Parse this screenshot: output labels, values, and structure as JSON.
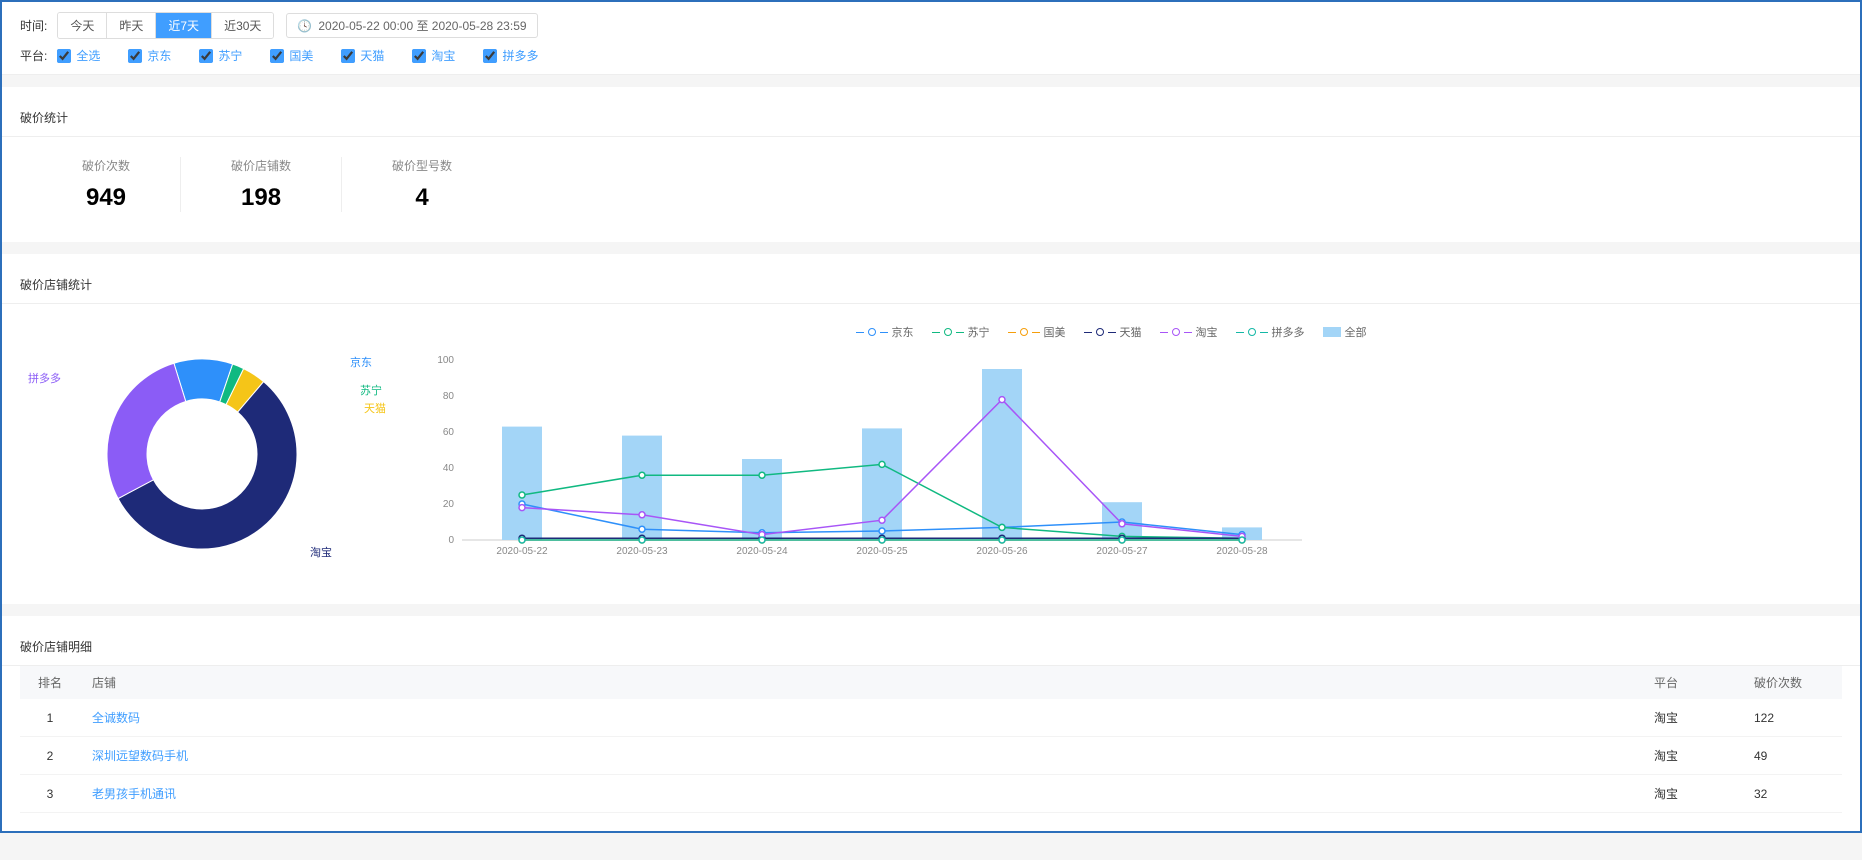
{
  "filters": {
    "time_label": "时间:",
    "buttons": [
      "今天",
      "昨天",
      "近7天",
      "近30天"
    ],
    "active_button": "近7天",
    "date_range": "2020-05-22 00:00 至 2020-05-28 23:59",
    "platform_label": "平台:",
    "platforms": [
      "全选",
      "京东",
      "苏宁",
      "国美",
      "天猫",
      "淘宝",
      "拼多多"
    ]
  },
  "stats_section": {
    "title": "破价统计",
    "cards": [
      {
        "label": "破价次数",
        "value": "949"
      },
      {
        "label": "破价店铺数",
        "value": "198"
      },
      {
        "label": "破价型号数",
        "value": "4"
      }
    ]
  },
  "chart_section": {
    "title": "破价店铺统计",
    "donut": {
      "labels": {
        "jd": "京东",
        "sn": "苏宁",
        "tm": "天猫",
        "tb": "淘宝",
        "pdd": "拼多多"
      }
    },
    "line_legend": {
      "jd": "京东",
      "sn": "苏宁",
      "gm": "国美",
      "tm": "天猫",
      "tb": "淘宝",
      "pdd": "拼多多",
      "all": "全部"
    }
  },
  "chart_data": [
    {
      "type": "pie",
      "title": "破价店铺统计",
      "series": [
        {
          "name": "京东",
          "value": 10,
          "color": "#2e90fa"
        },
        {
          "name": "苏宁",
          "value": 2,
          "color": "#10b981"
        },
        {
          "name": "天猫",
          "value": 4,
          "color": "#f5c518"
        },
        {
          "name": "淘宝",
          "value": 56,
          "color": "#1e2a78"
        },
        {
          "name": "拼多多",
          "value": 28,
          "color": "#8b5cf6"
        }
      ]
    },
    {
      "type": "line",
      "categories": [
        "2020-05-22",
        "2020-05-23",
        "2020-05-24",
        "2020-05-25",
        "2020-05-26",
        "2020-05-27",
        "2020-05-28"
      ],
      "ylim": [
        0,
        100
      ],
      "yticks": [
        0,
        20,
        40,
        60,
        80,
        100
      ],
      "series": [
        {
          "name": "京东",
          "color": "#2e90fa",
          "values": [
            20,
            6,
            4,
            5,
            7,
            10,
            3
          ]
        },
        {
          "name": "苏宁",
          "color": "#10b981",
          "values": [
            25,
            36,
            36,
            42,
            7,
            2,
            1
          ]
        },
        {
          "name": "国美",
          "color": "#f59e0b",
          "values": [
            0,
            0,
            0,
            0,
            0,
            0,
            0
          ]
        },
        {
          "name": "天猫",
          "color": "#1e2a78",
          "values": [
            1,
            1,
            1,
            1,
            1,
            1,
            1
          ]
        },
        {
          "name": "淘宝",
          "color": "#a855f7",
          "values": [
            18,
            14,
            3,
            11,
            78,
            9,
            2
          ]
        },
        {
          "name": "拼多多",
          "color": "#14b8a6",
          "values": [
            0,
            0,
            0,
            0,
            0,
            0,
            0
          ]
        }
      ],
      "bars": {
        "name": "全部",
        "color": "#a3d5f7",
        "values": [
          63,
          58,
          45,
          62,
          95,
          21,
          7
        ]
      }
    }
  ],
  "detail_section": {
    "title": "破价店铺明细",
    "columns": {
      "rank": "排名",
      "shop": "店铺",
      "platform": "平台",
      "count": "破价次数"
    },
    "rows": [
      {
        "rank": "1",
        "shop": "全诚数码",
        "platform": "淘宝",
        "count": "122"
      },
      {
        "rank": "2",
        "shop": "深圳远望数码手机",
        "platform": "淘宝",
        "count": "49"
      },
      {
        "rank": "3",
        "shop": "老男孩手机通讯",
        "platform": "淘宝",
        "count": "32"
      }
    ]
  }
}
